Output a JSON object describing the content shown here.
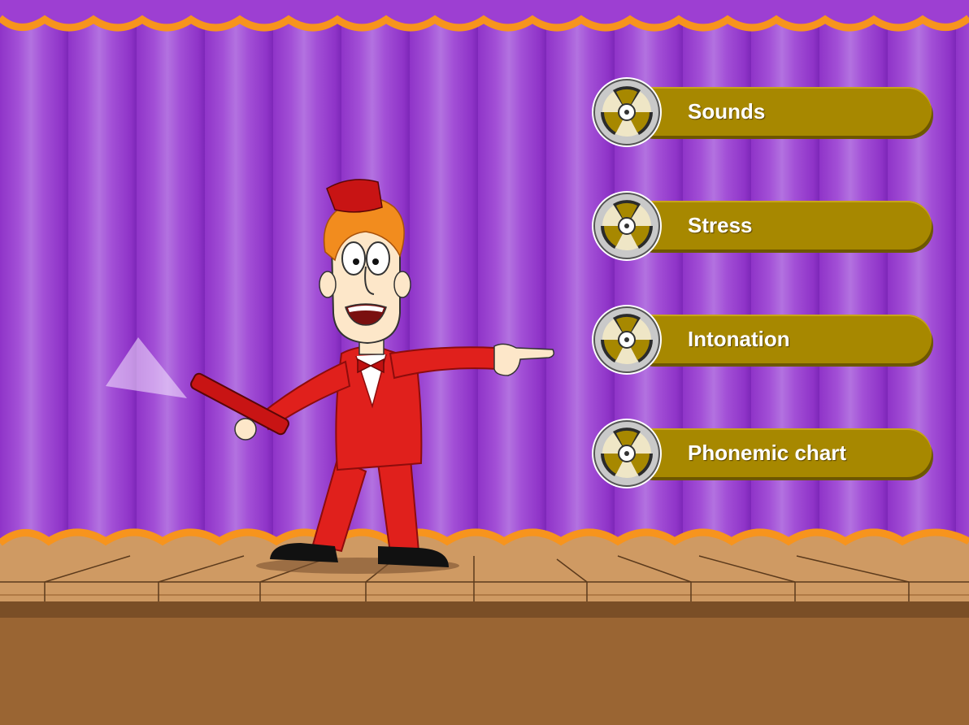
{
  "menu": {
    "items": [
      {
        "label": "Sounds"
      },
      {
        "label": "Stress"
      },
      {
        "label": "Intonation"
      },
      {
        "label": "Phonemic chart"
      }
    ]
  },
  "icons": {
    "menu_item_icon": "film-reel-icon",
    "character": "presenter-with-flashlight"
  },
  "colors": {
    "curtain": "#a24fd6",
    "valance_trim": "#f7941d",
    "button": "#a78800",
    "button_text": "#ffffff",
    "stage_floor": "#cf9a63",
    "suit": "#e0201c"
  }
}
